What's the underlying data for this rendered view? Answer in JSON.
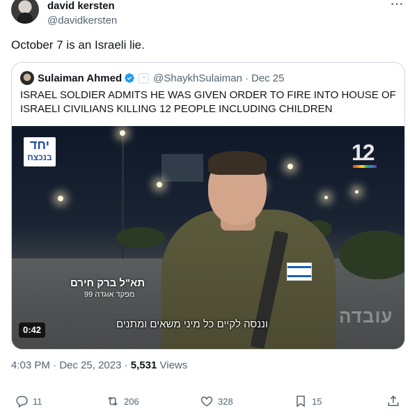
{
  "author": {
    "name": "david kersten",
    "handle": "@davidkersten",
    "more_label": "···"
  },
  "tweet": {
    "text": "October 7 is an Israeli lie."
  },
  "quote": {
    "name": "Sulaiman Ahmed",
    "badge": "ꞏꞏ",
    "handle": "@ShaykhSulaiman",
    "dot": "·",
    "date": "Dec 25",
    "text": "ISRAEL SOLDIER ADMITS HE WAS GIVEN ORDER TO FIRE INTO HOUSE OF ISRAELI CIVILIANS KILLING 12 PEOPLE INCLUDING CHILDREN",
    "media": {
      "channel_logo_top": "יחד",
      "channel_logo_bottom": "בנכצח",
      "channel_number": "12",
      "caption_name": "תא\"ל ברק חירם",
      "caption_role": "מפקד אוגדה 99",
      "subtitle": "וננסה לקיים כל מיני משאים ומתנים",
      "watermark": "עובדה",
      "duration": "0:42"
    }
  },
  "meta": {
    "time": "4:03 PM",
    "dot": "·",
    "date": "Dec 25, 2023",
    "views_count": "5,531",
    "views_label": "Views"
  },
  "actions": {
    "replies": "11",
    "reposts": "206",
    "likes": "328",
    "bookmarks": "15"
  },
  "colors": {
    "text_primary": "#0f1419",
    "text_secondary": "#536471",
    "border": "#cfd9de",
    "verified": "#1d9bf0"
  }
}
